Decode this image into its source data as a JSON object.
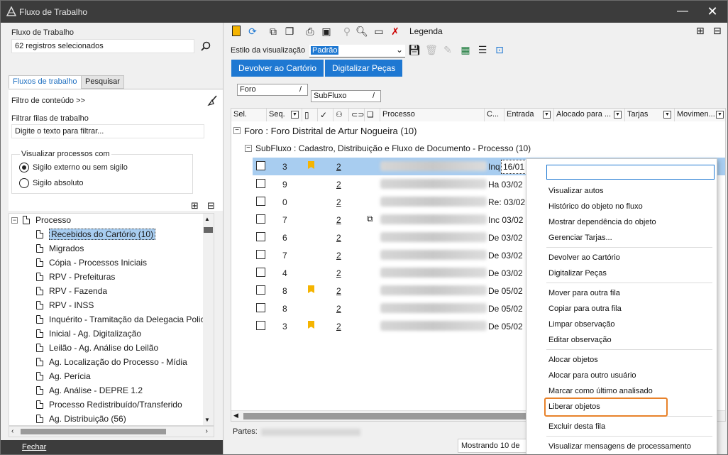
{
  "window": {
    "title": "Fluxo de Trabalho",
    "close_glyph": "✕",
    "minimize_glyph": "—"
  },
  "left": {
    "workflow_label": "Fluxo de Trabalho",
    "workflow_value": "62 registros selecionados",
    "tabs": [
      "Fluxos de trabalho",
      "Pesquisar"
    ],
    "content_filter": "Filtro de conteúdo >>",
    "filter_queues_label": "Filtrar filas de trabalho",
    "filter_placeholder": "Digite o texto para filtrar...",
    "view_group_label": "Visualizar processos com",
    "radio_options": [
      "Sigilo externo ou sem sigilo",
      "Sigilo absoluto"
    ],
    "tree_root": "Processo",
    "tree_items": [
      "Recebidos do Cartório (10)",
      "Migrados",
      "Cópia - Processos Iniciais",
      "RPV - Prefeituras",
      "RPV - Fazenda",
      "RPV - INSS",
      "Inquérito - Tramitação da Delegacia Policia",
      "Inicial - Ag. Digitalização",
      "Leilão - Ag. Análise do Leilão",
      "Ag. Localização do Processo - Mídia",
      "Ag. Perícia",
      "Ag. Análise - DEPRE 1.2",
      "Processo Redistribuído/Transferido",
      "Ag. Distribuição (56)"
    ],
    "close_label": "Fechar"
  },
  "right": {
    "legend_label": "Legenda",
    "view_style_label": "Estilo da visualização",
    "view_style_value": "Padrão",
    "action_buttons": [
      "Devolver ao Cartório",
      "Digitalizar Peças"
    ],
    "group_chips": [
      "Foro",
      "SubFluxo"
    ],
    "group_chip_sep": "/",
    "columns": [
      "Sel.",
      "Seq.",
      "Processo",
      "C...",
      "Entrada",
      "Alocado para ...",
      "Tarjas",
      "Movimen..."
    ],
    "group_foro": "Foro : Foro Distrital de Artur Nogueira  (10)",
    "group_subfluxo": "SubFluxo : Cadastro, Distribuição e Fluxo de Documento - Processo  (10)",
    "rows": [
      {
        "seq": "3",
        "link": "2",
        "proc": "Inq",
        "date": "16/01"
      },
      {
        "seq": "9",
        "link": "2",
        "proc": "Ha 03/02",
        "date": ""
      },
      {
        "seq": "0",
        "link": "2",
        "proc": "Re: 03/02",
        "date": ""
      },
      {
        "seq": "7",
        "link": "2",
        "proc": "Inc 03/02",
        "date": ""
      },
      {
        "seq": "6",
        "link": "2",
        "proc": "De 03/02",
        "date": ""
      },
      {
        "seq": "7",
        "link": "2",
        "proc": "De 03/02",
        "date": ""
      },
      {
        "seq": "4",
        "link": "2",
        "proc": "De 03/02",
        "date": ""
      },
      {
        "seq": "8",
        "link": "2",
        "proc": "De 05/02",
        "date": ""
      },
      {
        "seq": "8",
        "link": "2",
        "proc": "De 05/02",
        "date": ""
      },
      {
        "seq": "3",
        "link": "2",
        "proc": "De 05/02",
        "date": ""
      }
    ],
    "parties_label": "Partes:",
    "showing_label": "Mostrando 10 de"
  },
  "context_menu": {
    "items": [
      "Visualizar autos",
      "Histórico do objeto no fluxo",
      "Mostrar dependência do objeto",
      "Gerenciar Tarjas...",
      "Devolver ao Cartório",
      "Digitalizar Peças",
      "Mover para outra fila",
      "Copiar para outra fila",
      "Limpar observação",
      "Editar observação",
      "Alocar objetos",
      "Alocar para outro usuário",
      "Marcar como último analisado",
      "Liberar objetos",
      "Excluir desta fila",
      "Visualizar mensagens de processamento"
    ],
    "highlight_color": "#e8822a"
  },
  "colors": {
    "accent": "#1e78d2",
    "titlebar": "#3c3c3c",
    "selected_row": "#a8cdf0",
    "bookmark": "#f5b400"
  }
}
